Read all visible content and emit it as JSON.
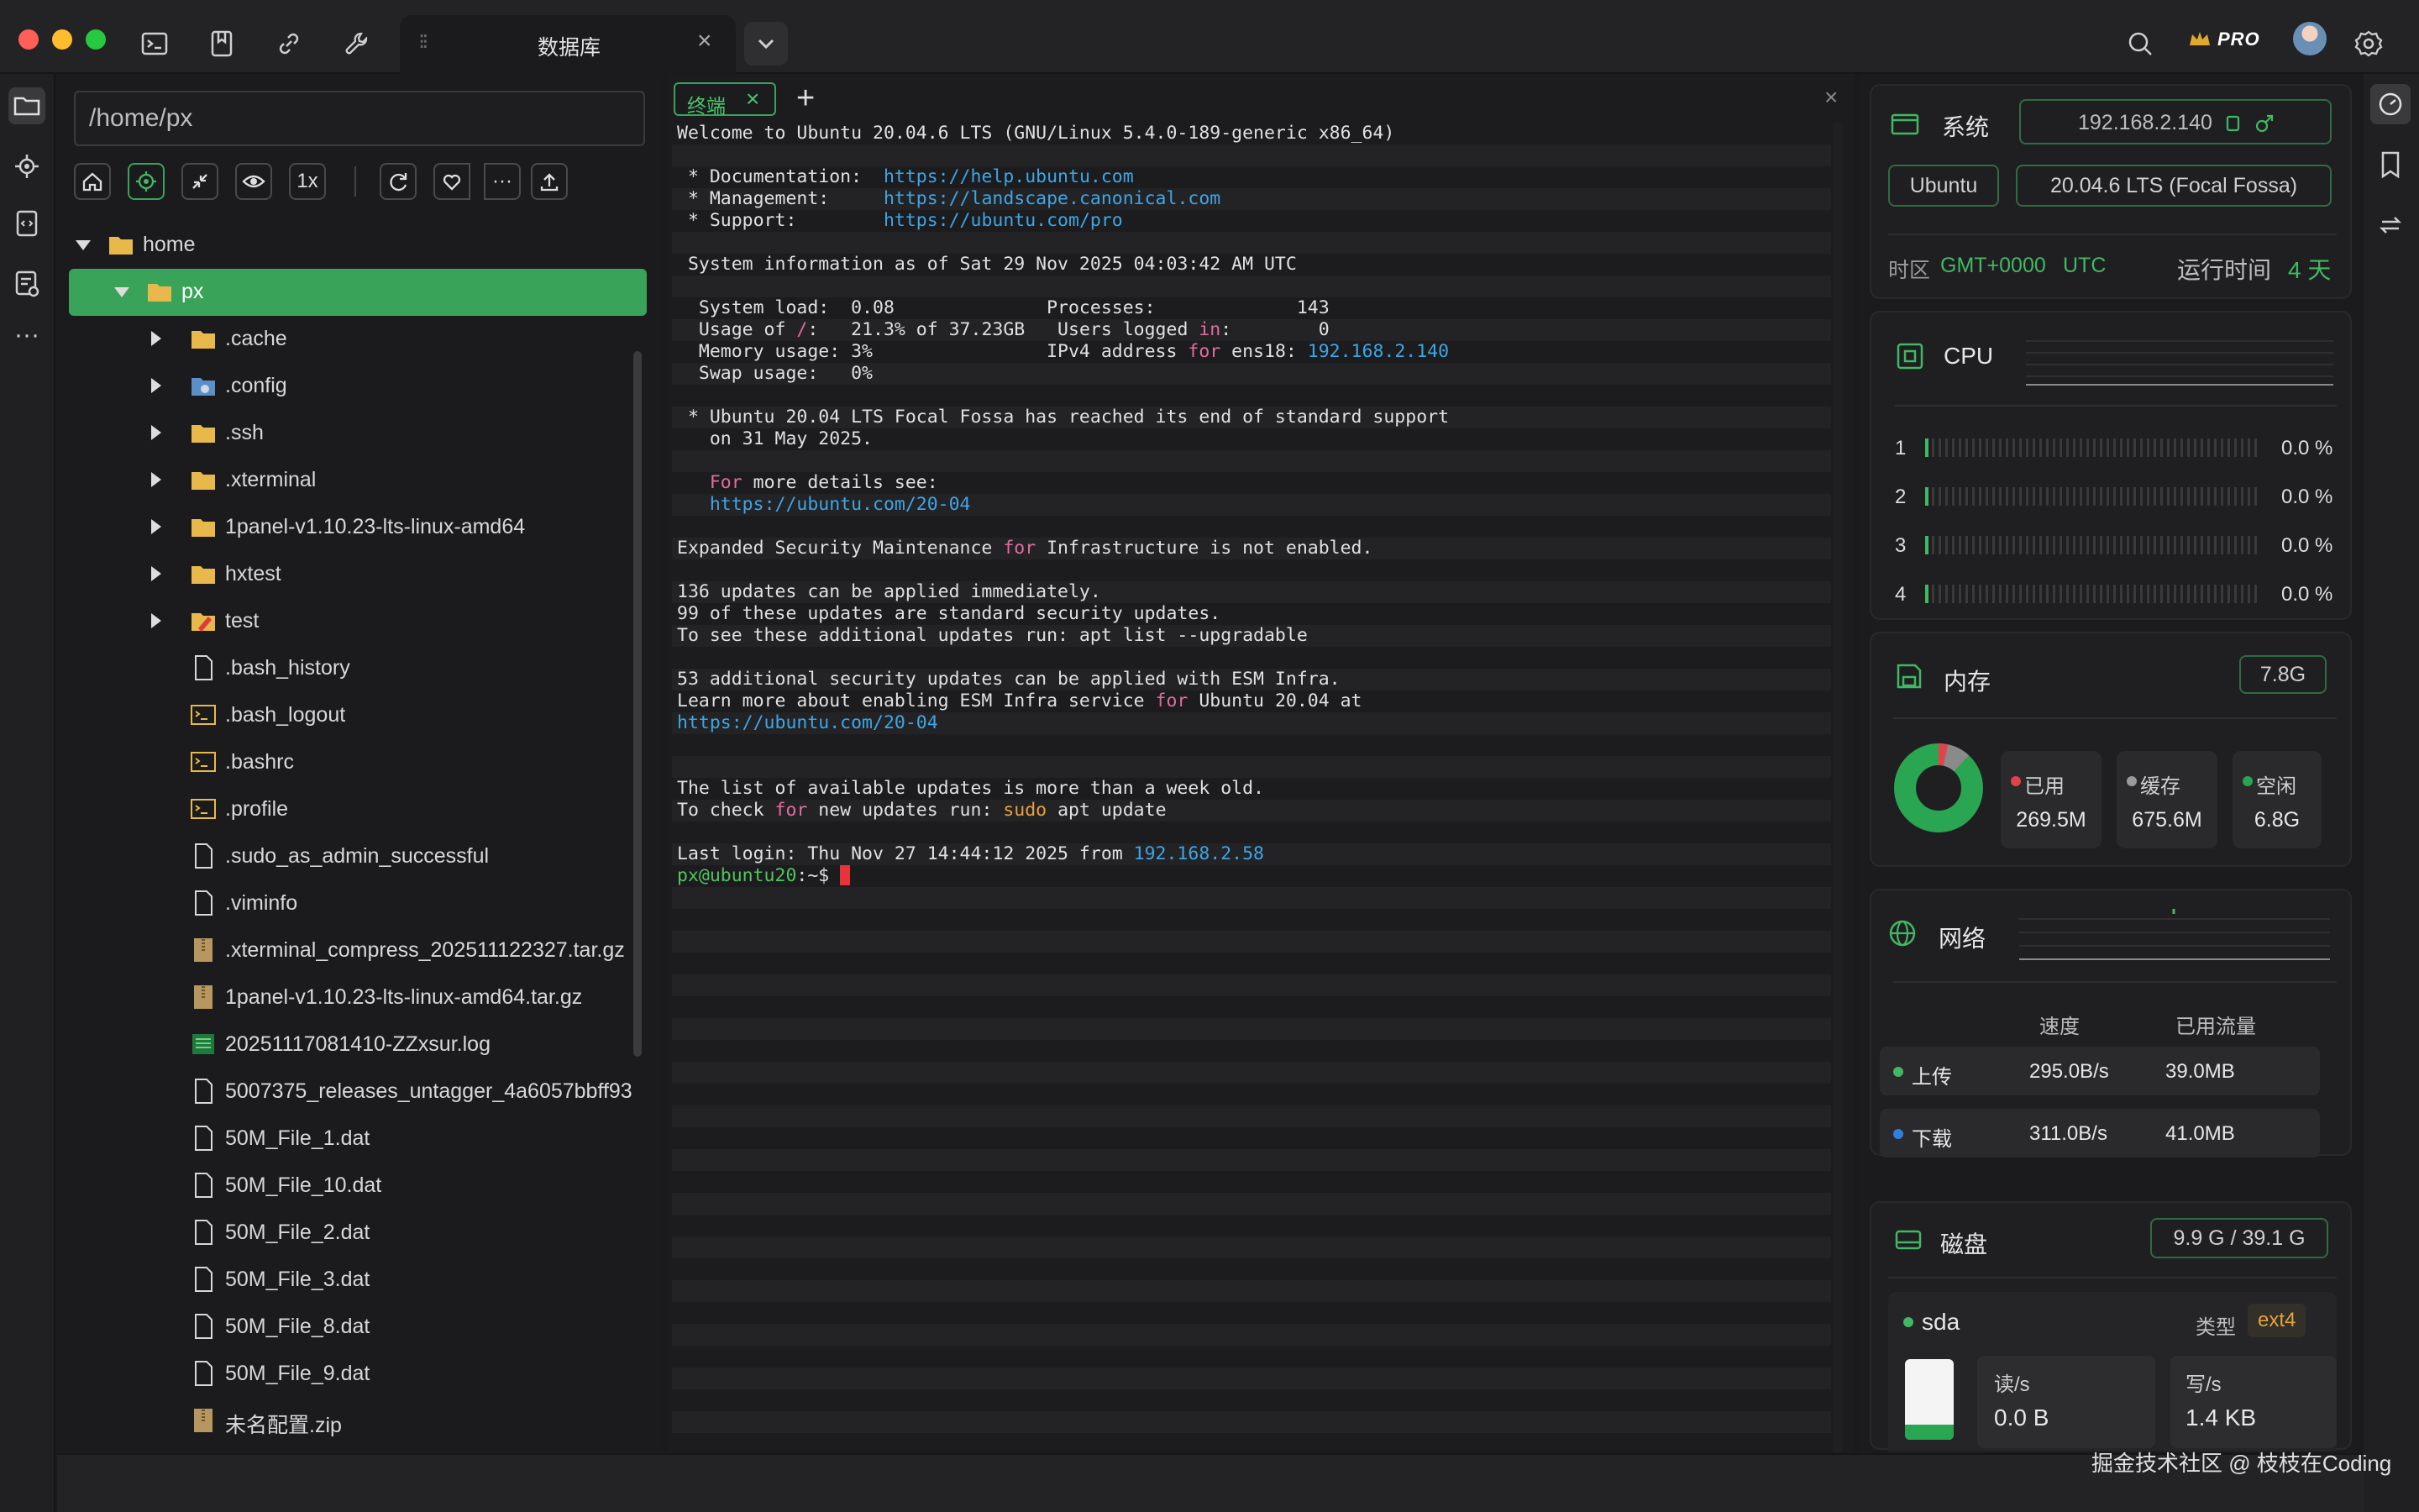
{
  "window": {
    "active_tab": "数据库",
    "pro_label": "PRO"
  },
  "files": {
    "path": "/home/px",
    "zoom_label": "1x",
    "more_label": "···",
    "tree": [
      {
        "name": "home",
        "kind": "folder",
        "depth": 0,
        "expanded": true
      },
      {
        "name": "px",
        "kind": "folder",
        "depth": 1,
        "expanded": true,
        "selected": true
      },
      {
        "name": ".cache",
        "kind": "folder",
        "depth": 2
      },
      {
        "name": ".config",
        "kind": "folder-config",
        "depth": 2
      },
      {
        "name": ".ssh",
        "kind": "folder",
        "depth": 2
      },
      {
        "name": ".xterminal",
        "kind": "folder",
        "depth": 2
      },
      {
        "name": "1panel-v1.10.23-lts-linux-amd64",
        "kind": "folder",
        "depth": 2
      },
      {
        "name": "hxtest",
        "kind": "folder",
        "depth": 2
      },
      {
        "name": "test",
        "kind": "folder-test",
        "depth": 2
      },
      {
        "name": ".bash_history",
        "kind": "file",
        "depth": 2
      },
      {
        "name": ".bash_logout",
        "kind": "script",
        "depth": 2
      },
      {
        "name": ".bashrc",
        "kind": "script",
        "depth": 2
      },
      {
        "name": ".profile",
        "kind": "script",
        "depth": 2
      },
      {
        "name": ".sudo_as_admin_successful",
        "kind": "file",
        "depth": 2
      },
      {
        "name": ".viminfo",
        "kind": "file",
        "depth": 2
      },
      {
        "name": ".xterminal_compress_202511122327.tar.gz",
        "kind": "archive",
        "depth": 2
      },
      {
        "name": "1panel-v1.10.23-lts-linux-amd64.tar.gz",
        "kind": "archive",
        "depth": 2
      },
      {
        "name": "20251117081410-ZZxsur.log",
        "kind": "log",
        "depth": 2
      },
      {
        "name": "5007375_releases_untagger_4a6057bbff93",
        "kind": "file",
        "depth": 2
      },
      {
        "name": "50M_File_1.dat",
        "kind": "file",
        "depth": 2
      },
      {
        "name": "50M_File_10.dat",
        "kind": "file",
        "depth": 2
      },
      {
        "name": "50M_File_2.dat",
        "kind": "file",
        "depth": 2
      },
      {
        "name": "50M_File_3.dat",
        "kind": "file",
        "depth": 2
      },
      {
        "name": "50M_File_8.dat",
        "kind": "file",
        "depth": 2
      },
      {
        "name": "50M_File_9.dat",
        "kind": "file",
        "depth": 2
      },
      {
        "name": "未名配置.zip",
        "kind": "archive",
        "depth": 2
      }
    ]
  },
  "terminal": {
    "tab_label": "终端",
    "add_label": "+",
    "close_label": "×",
    "lines": [
      [
        {
          "t": "Welcome to Ubuntu 20.04.6 LTS (GNU/Linux 5.4.0-189-generic x86_64)"
        }
      ],
      [],
      [
        {
          "t": " * Documentation:  "
        },
        {
          "t": "https://help.ubuntu.com",
          "c": "link"
        }
      ],
      [
        {
          "t": " * Management:     "
        },
        {
          "t": "https://landscape.canonical.com",
          "c": "link"
        }
      ],
      [
        {
          "t": " * Support:        "
        },
        {
          "t": "https://ubuntu.com/pro",
          "c": "link"
        }
      ],
      [],
      [
        {
          "t": " System information as of Sat 29 Nov 2025 04:03:42 AM UTC"
        }
      ],
      [],
      [
        {
          "t": "  System load:  0.08              Processes:             143"
        }
      ],
      [
        {
          "t": "  Usage of "
        },
        {
          "t": "/",
          "c": "kw"
        },
        {
          "t": ":   21.3% of 37.23GB   Users logged "
        },
        {
          "t": "in",
          "c": "kw"
        },
        {
          "t": ":        0"
        }
      ],
      [
        {
          "t": "  Memory usage: 3%                IPv4 address "
        },
        {
          "t": "for",
          "c": "kw"
        },
        {
          "t": " ens18: "
        },
        {
          "t": "192.168.2.140",
          "c": "link"
        }
      ],
      [
        {
          "t": "  Swap usage:   0%"
        }
      ],
      [],
      [
        {
          "t": " * Ubuntu 20.04 LTS Focal Fossa has reached its end of standard support"
        }
      ],
      [
        {
          "t": "   on 31 May 2025."
        }
      ],
      [],
      [
        {
          "t": "   "
        },
        {
          "t": "For",
          "c": "kw"
        },
        {
          "t": " more details see:"
        }
      ],
      [
        {
          "t": "   "
        },
        {
          "t": "https://ubuntu.com/20-04",
          "c": "link"
        }
      ],
      [],
      [
        {
          "t": "Expanded Security Maintenance "
        },
        {
          "t": "for",
          "c": "kw"
        },
        {
          "t": " Infrastructure is not enabled."
        }
      ],
      [],
      [
        {
          "t": "136 updates can be applied immediately."
        }
      ],
      [
        {
          "t": "99 of these updates are standard security updates."
        }
      ],
      [
        {
          "t": "To see these additional updates run: apt list --upgradable"
        }
      ],
      [],
      [
        {
          "t": "53 additional security updates can be applied with ESM Infra."
        }
      ],
      [
        {
          "t": "Learn more about enabling ESM Infra service "
        },
        {
          "t": "for",
          "c": "kw"
        },
        {
          "t": " Ubuntu 20.04 at"
        }
      ],
      [
        {
          "t": "https://ubuntu.com/20-04",
          "c": "link"
        }
      ],
      [],
      [],
      [
        {
          "t": "The list of available updates is more than a week old."
        }
      ],
      [
        {
          "t": "To check "
        },
        {
          "t": "for",
          "c": "kw"
        },
        {
          "t": " new updates run: "
        },
        {
          "t": "sudo",
          "c": "sudo"
        },
        {
          "t": " apt update"
        }
      ],
      [],
      [
        {
          "t": "Last login: Thu Nov 27 14:44:12 2025 from "
        },
        {
          "t": "192.168.2.58",
          "c": "link"
        }
      ],
      [
        {
          "t": "px@ubuntu20",
          "c": "prompt"
        },
        {
          "t": ":~$ "
        },
        {
          "t": "",
          "c": "cursor"
        }
      ]
    ]
  },
  "system": {
    "title": "系统",
    "ip": "192.168.2.140",
    "os": "Ubuntu",
    "version": "20.04.6 LTS (Focal Fossa)",
    "tz_label": "时区",
    "tz_value": "GMT+0000",
    "tz_name": "UTC",
    "uptime_label": "运行时间",
    "uptime_value": "4 天"
  },
  "cpu": {
    "title": "CPU",
    "cores": [
      {
        "id": "1",
        "pct": "0.0 %"
      },
      {
        "id": "2",
        "pct": "0.0 %"
      },
      {
        "id": "3",
        "pct": "0.0 %"
      },
      {
        "id": "4",
        "pct": "0.0 %"
      }
    ]
  },
  "memory": {
    "title": "内存",
    "total": "7.8G",
    "used_label": "已用",
    "used_value": "269.5M",
    "cache_label": "缓存",
    "cache_value": "675.6M",
    "free_label": "空闲",
    "free_value": "6.8G"
  },
  "network": {
    "title": "网络",
    "col_speed": "速度",
    "col_traffic": "已用流量",
    "upload_label": "上传",
    "upload_speed": "295.0B/s",
    "upload_traffic": "39.0MB",
    "download_label": "下载",
    "download_speed": "311.0B/s",
    "download_traffic": "41.0MB"
  },
  "disk": {
    "title": "磁盘",
    "usage": "9.9 G / 39.1 G",
    "device": "sda",
    "type_label": "类型",
    "type_value": "ext4",
    "read_label": "读/s",
    "read_value": "0.0 B",
    "write_label": "写/s",
    "write_value": "1.4 KB"
  },
  "watermark": "掘金技术社区 @ 枝枝在Coding",
  "colors": {
    "accent": "#3aa35a",
    "link": "#3ea6e6",
    "keyword": "#e06c9f"
  }
}
